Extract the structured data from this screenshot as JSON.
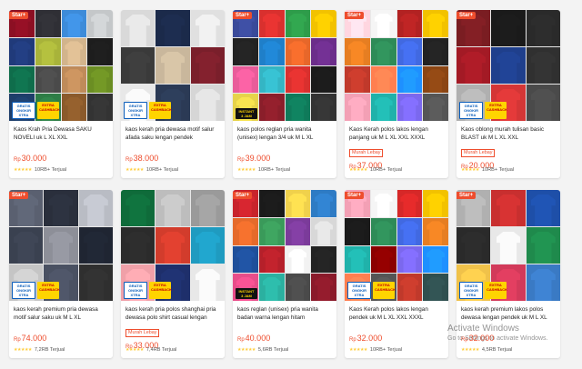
{
  "products": [
    {
      "title": "Kaos Krah Pria Dewasa SAKU NOVELI uk L XL XXL",
      "tag": "",
      "price_currency": "Rp",
      "price": "30.000",
      "rating_icon": "5-stars",
      "sold": "10RB+ Terjual",
      "badges": [
        "GRATIS ONGKIR XTRA",
        "EXTRA CASHBACK"
      ],
      "star_label": "Star+",
      "grid_cols": 4,
      "colors": [
        "#8c0f23",
        "#2f2f35",
        "#3d8bd9",
        "#c4c7c9",
        "#203a7a",
        "#a8b33a",
        "#d2b48c",
        "#1d1d1d",
        "#0f6d4b",
        "#4a4a4a",
        "#bf8b5a",
        "#6b8e23",
        "#1e3e6a",
        "#2d7d46",
        "#8b5a2b",
        "#333"
      ]
    },
    {
      "title": "kaos kerah pria dewasa motif salur afada saku lengan pendek",
      "tag": "",
      "price_currency": "Rp",
      "price": "38.000",
      "rating_icon": "5-stars",
      "sold": "10RB+ Terjual",
      "badges": [
        "GRATIS ONGKIR XTRA",
        "EXTRA CASHBACK"
      ],
      "star_label": "",
      "grid_cols": 3,
      "colors": [
        "#d9d9d9",
        "#1b2a4a",
        "#e0e0e0",
        "#3a3a3a",
        "#c9b79c",
        "#7a1f2b",
        "#e8e8e8",
        "#2b3a55",
        "#d6d6d6"
      ]
    },
    {
      "title": "kaos polos reglan pria wanita (unisex) lengan 3/4 uk M L XL",
      "tag": "",
      "price_currency": "Rp",
      "price": "39.000",
      "rating_icon": "5-stars",
      "sold": "10RB+ Terjual",
      "badges": [
        "INSTANT 3 JAM"
      ],
      "star_label": "Star+",
      "grid_cols": 4,
      "colors": [
        "#3a4a9a",
        "#d9302e",
        "#2e9c4a",
        "#f2c200",
        "#222",
        "#1f7fc9",
        "#e7672a",
        "#6b2d8a",
        "#e95c9a",
        "#34b5c4",
        "#d9302e",
        "#1a1a1a",
        "#e6d34a",
        "#8a1e2a",
        "#0f7a5a",
        "#333"
      ]
    },
    {
      "title": "Kaos Kerah polos lakos lengan panjang uk M L XL XXL XXXL",
      "tag": "Murah Lebay",
      "price_currency": "Rp",
      "price": "37.000",
      "rating_icon": "5-stars",
      "sold": "10RB+ Terjual",
      "badges": [],
      "star_label": "Star+",
      "grid_cols": 4,
      "colors": [
        "#ffd6e0",
        "#f5f5f5",
        "#b22222",
        "#f2c200",
        "#e67e22",
        "#2e8b57",
        "#4169e1",
        "#222",
        "#c0392b",
        "#ff7f50",
        "#1e90ff",
        "#8b4513",
        "#f3a0b5",
        "#20b2aa",
        "#7b68ee",
        "#555"
      ]
    },
    {
      "title": "Kaos oblong murah tulisan basic BLAST uk M L XL XXL",
      "tag": "Murah Lebay",
      "price_currency": "Rp",
      "price": "20.000",
      "rating_icon": "5-stars",
      "sold": "10RB+ Terjual",
      "badges": [
        "GRATIS ONGKIR XTRA",
        "EXTRA CASHBACK"
      ],
      "star_label": "Star+",
      "grid_cols": 3,
      "colors": [
        "#7a1d22",
        "#1a1a1a",
        "#2a2a2a",
        "#a31a25",
        "#1f3f8c",
        "#303030",
        "#b0b0b0",
        "#d43636",
        "#4a4a4a"
      ]
    },
    {
      "title": "kaos kerah premium pria dewasa motif salur saku uk M L XL",
      "tag": "",
      "price_currency": "Rp",
      "price": "74.000",
      "rating_icon": "5-stars",
      "sold": "7,2RB Terjual",
      "badges": [
        "GRATIS ONGKIR XTRA",
        "EXTRA CASHBACK"
      ],
      "star_label": "Star+",
      "grid_cols": 3,
      "colors": [
        "#5a6070",
        "#2a2f3c",
        "#b9bcc4",
        "#3a4150",
        "#8d8f98",
        "#1f2532",
        "#c5c5c5",
        "#4a5162",
        "#2f2f2f"
      ]
    },
    {
      "title": "kaos kerah pria polos shanghai pria dewasa polo shirt casual lengan",
      "tag": "Murah Lebay",
      "price_currency": "Rp",
      "price": "33.000",
      "rating_icon": "5-stars",
      "sold": "7,4RB Terjual",
      "badges": [
        "GRATIS ONGKIR XTRA",
        "EXTRA CASHBACK"
      ],
      "star_label": "",
      "grid_cols": 3,
      "colors": [
        "#0f6b3a",
        "#bdbdbd",
        "#9a9a9a",
        "#2b2b2b",
        "#d23c2c",
        "#1f9bc0",
        "#f0a0a8",
        "#1e2f6b",
        "#e8e8e8"
      ]
    },
    {
      "title": "kaos reglan (unisex) pria wanita badan warna lengan hitam",
      "tag": "",
      "price_currency": "Rp",
      "price": "40.000",
      "rating_icon": "5-stars",
      "sold": "5,6RB Terjual",
      "badges": [
        "INSTANT 3 JAM"
      ],
      "star_label": "Star+",
      "grid_cols": 4,
      "colors": [
        "#c8232c",
        "#1a1a1a",
        "#f0d14c",
        "#2e7bc4",
        "#e56a2b",
        "#3a9a5a",
        "#7b3b9a",
        "#d8d8d8",
        "#1f4f9a",
        "#b5202a",
        "#f2f2f2",
        "#222",
        "#e84d8a",
        "#2bb0a0",
        "#4a4a4a",
        "#8a1a2a"
      ]
    },
    {
      "title": "Kaos Kerah polos lakos lengan pendek uk M L XL XXL XXXL",
      "tag": "",
      "price_currency": "Rp",
      "price": "32.000",
      "rating_icon": "5-stars",
      "sold": "10RB+ Terjual",
      "badges": [
        "GRATIS ONGKIR XTRA",
        "EXTRA CASHBACK"
      ],
      "star_label": "Star+",
      "grid_cols": 4,
      "colors": [
        "#f3a0b5",
        "#f5f5f5",
        "#d62828",
        "#f2c200",
        "#1a1a1a",
        "#2e8b57",
        "#4169e1",
        "#e67e22",
        "#20b2aa",
        "#8b0000",
        "#7b68ee",
        "#1e90ff",
        "#ff7f50",
        "#555",
        "#c0392b",
        "#2f4f4f"
      ]
    },
    {
      "title": "kaos kerah premium lakos polos dewasa lengan pendek uk M L XL",
      "tag": "",
      "price_currency": "Rp",
      "price": "32.000",
      "rating_icon": "5-stars",
      "sold": "4,5RB Terjual",
      "badges": [
        "GRATIS ONGKIR XTRA",
        "EXTRA CASHBACK"
      ],
      "star_label": "Star+",
      "grid_cols": 3,
      "colors": [
        "#b0b0b0",
        "#c82f2f",
        "#1e4fa8",
        "#2a2a2a",
        "#e8e8e8",
        "#1f8a4c",
        "#f0c24a",
        "#d23a5a",
        "#3a7ac4"
      ]
    }
  ],
  "watermark": {
    "line1": "Activate Windows",
    "line2": "Go to Settings to activate Windows."
  }
}
